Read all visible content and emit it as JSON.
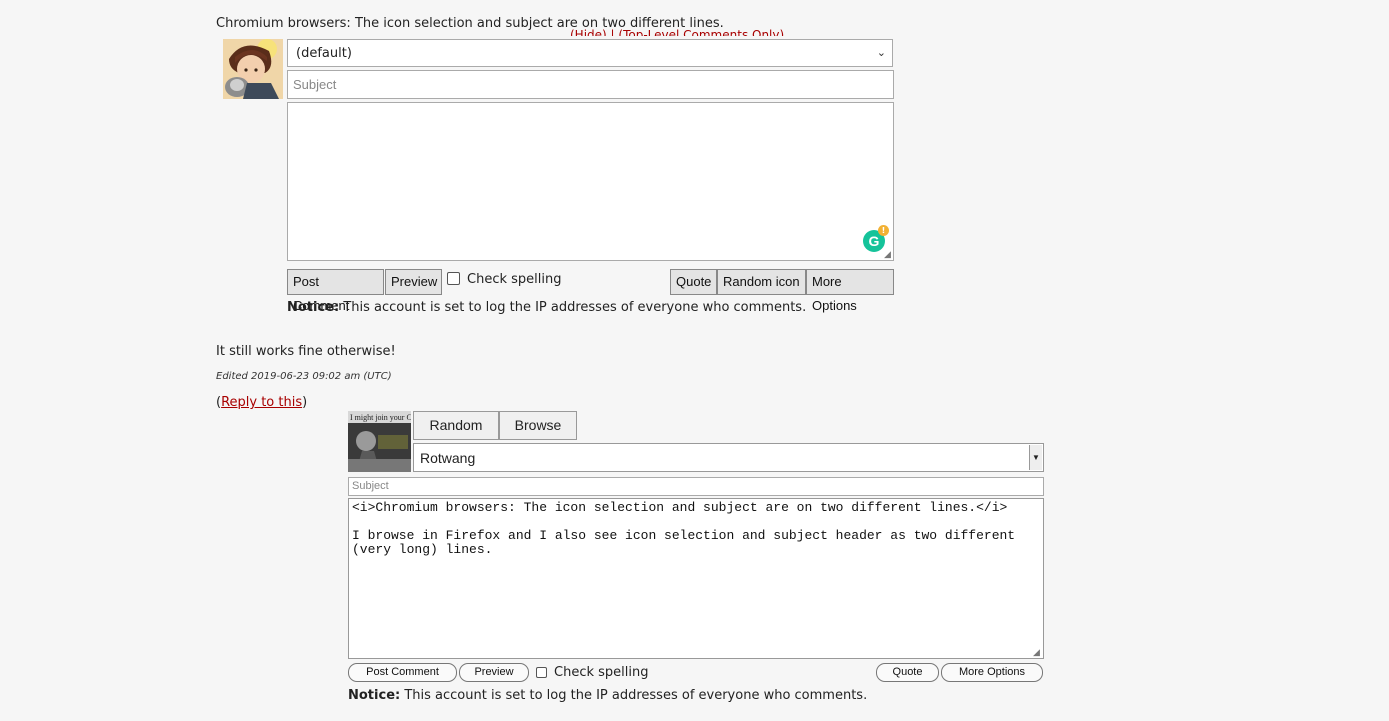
{
  "top_form": {
    "quote_text": "Chromium browsers: The icon selection and subject are on two different lines.",
    "overlap_links": "(Hide) | (Top-Level Comments Only)",
    "icon_select_value": "(default)",
    "subject_placeholder": "Subject",
    "buttons": {
      "post": "Post Comment",
      "preview": "Preview",
      "quote": "Quote",
      "random_icon": "Random icon",
      "more_options": "More Options"
    },
    "check_spelling": "Check spelling",
    "notice_label": "Notice:",
    "notice_text": "This account is set to log the IP addresses of everyone who comments."
  },
  "comment": {
    "text": "It still works fine otherwise!",
    "edited": "Edited 2019-06-23 09:02 am (UTC)",
    "reply_open": "(",
    "reply_link": "Reply to this",
    "reply_close": ")"
  },
  "bottom_form": {
    "avatar_caption": "I might join your Century",
    "tabs": {
      "random": "Random",
      "browse": "Browse"
    },
    "icon_select_value": "Rotwang",
    "subject_placeholder": "Subject",
    "body_text": "<i>Chromium browsers: The icon selection and subject are on two different lines.</i>\n\nI browse in Firefox and I also see icon selection and subject header as two different\n(very long) lines.",
    "buttons": {
      "post": "Post Comment",
      "preview": "Preview",
      "quote": "Quote",
      "more_options": "More Options"
    },
    "check_spelling": "Check spelling",
    "notice_label": "Notice:",
    "notice_text": "This account is set to log the IP addresses of everyone who comments."
  },
  "colors": {
    "link": "#a80000",
    "grammarly": "#15c39a",
    "background": "#f6f6f6"
  },
  "icons": [
    "chevron-down-icon",
    "grammarly-icon",
    "resize-handle-icon",
    "dropdown-arrow-icon"
  ]
}
